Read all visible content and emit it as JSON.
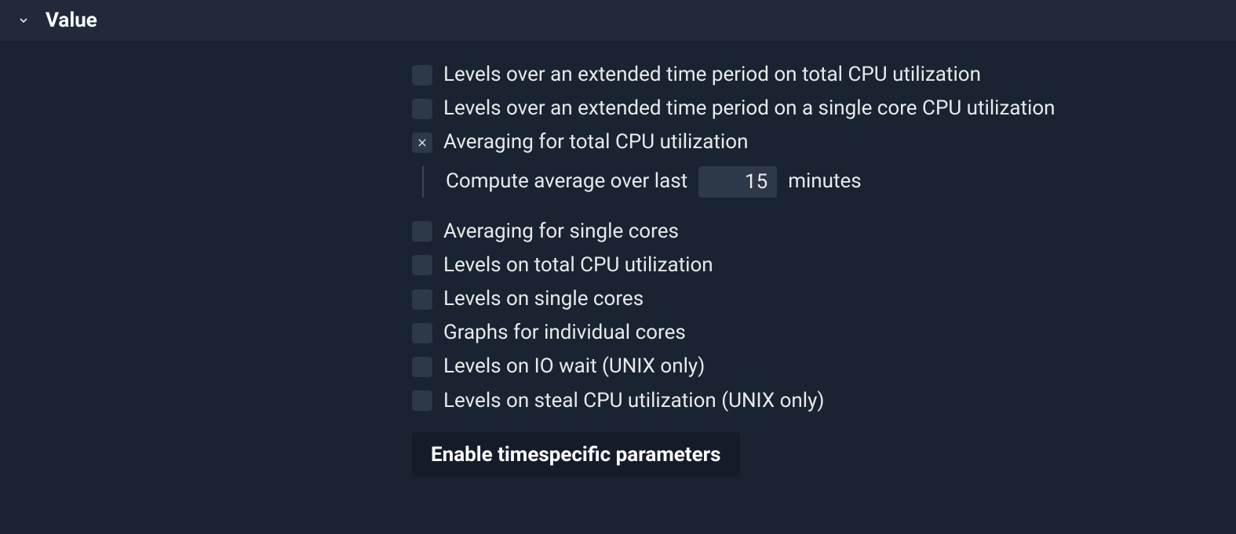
{
  "header": {
    "title": "Value"
  },
  "options": {
    "extended_total": {
      "label": "Levels over an extended time period on total CPU utilization",
      "checked": false
    },
    "extended_single": {
      "label": "Levels over an extended time period on a single core CPU utilization",
      "checked": false
    },
    "avg_total": {
      "label": "Averaging for total CPU utilization",
      "checked": true,
      "sub": {
        "prefix": "Compute average over last",
        "value": "15",
        "suffix": "minutes"
      }
    },
    "avg_single": {
      "label": "Averaging for single cores",
      "checked": false
    },
    "levels_total": {
      "label": "Levels on total CPU utilization",
      "checked": false
    },
    "levels_single": {
      "label": "Levels on single cores",
      "checked": false
    },
    "graphs_individual": {
      "label": "Graphs for individual cores",
      "checked": false
    },
    "levels_iowait": {
      "label": "Levels on IO wait (UNIX only)",
      "checked": false
    },
    "levels_steal": {
      "label": "Levels on steal CPU utilization (UNIX only)",
      "checked": false
    }
  },
  "button": {
    "enable_timespecific": "Enable timespecific parameters"
  }
}
